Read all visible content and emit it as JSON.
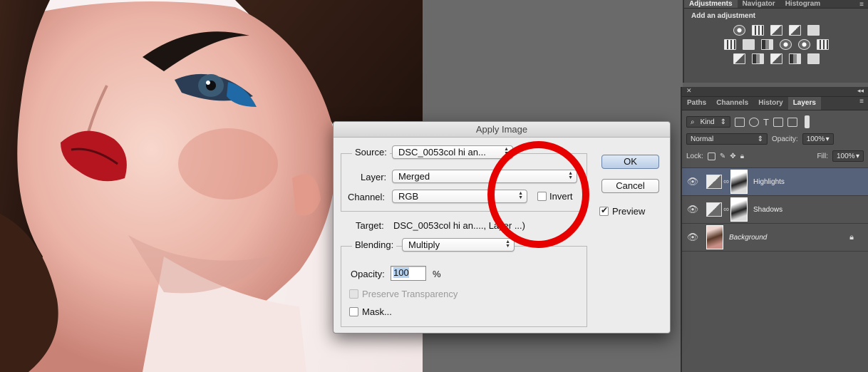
{
  "adjustments_panel": {
    "tabs": [
      "Adjustments",
      "Navigator",
      "Histogram"
    ],
    "active_tab": "Adjustments",
    "heading": "Add an adjustment"
  },
  "layers_panel": {
    "tabs": [
      "Paths",
      "Channels",
      "History",
      "Layers"
    ],
    "active_tab": "Layers",
    "filter_kind": "Kind",
    "blend_mode": "Normal",
    "opacity_label": "Opacity:",
    "opacity_value": "100%",
    "lock_label": "Lock:",
    "fill_label": "Fill:",
    "fill_value": "100%",
    "layers": [
      {
        "name": "Highlights",
        "selected": true
      },
      {
        "name": "Shadows",
        "selected": false
      },
      {
        "name": "Background",
        "selected": false
      }
    ]
  },
  "dialog": {
    "title": "Apply Image",
    "source_label": "Source:",
    "source_value": "DSC_0053col hi an...",
    "layer_label": "Layer:",
    "layer_value": "Merged",
    "channel_label": "Channel:",
    "channel_value": "RGB",
    "invert_label": "Invert",
    "invert_checked": false,
    "target_label": "Target:",
    "target_value": "DSC_0053col hi an...., Layer ...)",
    "blending_label": "Blending:",
    "blending_value": "Multiply",
    "opacity_label": "Opacity:",
    "opacity_value": "100",
    "opacity_unit": "%",
    "preserve_transparency_label": "Preserve Transparency",
    "mask_label": "Mask...",
    "ok_label": "OK",
    "cancel_label": "Cancel",
    "preview_label": "Preview",
    "preview_checked": true
  },
  "colors": {
    "annotation": "#e60000",
    "selected_layer": "#56627a",
    "panel_bg": "#535353"
  }
}
